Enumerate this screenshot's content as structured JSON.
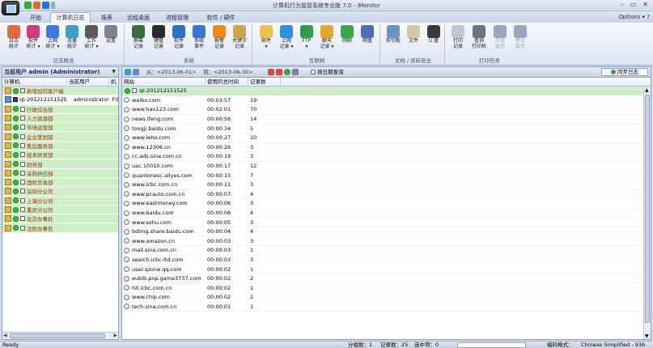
{
  "window": {
    "title": "计算机行为监管系统专业版 7.0 - iMonitor",
    "controls": [
      "–",
      "▭",
      "✕"
    ]
  },
  "tabs": {
    "items": [
      "开始",
      "计算机日志",
      "报表",
      "远程桌面",
      "进程管理",
      "软件 / 硬件"
    ],
    "options": "Options ▾ ?"
  },
  "ribbon": {
    "groups": [
      {
        "label": "日志概览",
        "buttons": [
          {
            "label": "日志\n统计",
            "color": "#e46b3a"
          },
          {
            "label": "软件\n统计 ▾",
            "color": "#d33c7a"
          },
          {
            "label": "上网\n统计 ▾",
            "color": "#3d7be0"
          },
          {
            "label": "流量\n统计",
            "color": "#3aa0c8"
          },
          {
            "label": "工作\n统计 ▾",
            "color": "#5a5a5a"
          },
          {
            "label": "设置",
            "color": "#7a8494"
          }
        ]
      },
      {
        "label": "系统",
        "buttons": [
          {
            "label": "屏幕\n记录",
            "color": "#3d6b3d"
          },
          {
            "label": "键盘\n记录",
            "color": "#2a2a2a"
          },
          {
            "label": "软件\n记录",
            "color": "#2f6fc4"
          },
          {
            "label": "系统\n事件",
            "color": "#3a78d8"
          },
          {
            "label": "报警\n记录",
            "color": "#f08a17"
          },
          {
            "label": "关键字\n记录",
            "color": "#c8a84a"
          }
        ]
      },
      {
        "label": "互联网",
        "buttons": [
          {
            "label": "邮件\n▾",
            "color": "#e8c24a"
          },
          {
            "label": "上网\n记录 ▾",
            "color": "#2f8fe0"
          },
          {
            "label": "FTP\n▾",
            "color": "#2f9f4a"
          },
          {
            "label": "聊天\n记录 ▾",
            "color": "#e0a82f"
          },
          {
            "label": "网邮",
            "color": "#38a84a"
          },
          {
            "label": "网盘",
            "color": "#4a6fb8"
          }
        ]
      },
      {
        "label": "文档 / 资料安全",
        "buttons": [
          {
            "label": "剪切板",
            "color": "#6a94c8"
          },
          {
            "label": "文件",
            "color": "#d4c8a0"
          },
          {
            "label": "U 盘",
            "color": "#3a3a3a"
          }
        ]
      },
      {
        "label": "打印任务",
        "buttons": [
          {
            "label": "打印\n记录",
            "color": "#bfc7d4"
          },
          {
            "label": "查询\n打印机",
            "color": "#6a7484"
          },
          {
            "label": "开始\n监控",
            "color": "#9aa7bf",
            "disabled": true
          },
          {
            "label": "停止\n监控",
            "color": "#9aa7bf",
            "disabled": true
          }
        ]
      }
    ]
  },
  "left_pane": {
    "header": "当前用户 admin (Administrator)",
    "columns": [
      "计算机",
      "当前用户",
      "机"
    ],
    "rows": [
      {
        "type": "dept",
        "name": "新增加的客户端"
      },
      {
        "type": "host",
        "name": "qt-201212151525",
        "user": "administrator",
        "mac": "F0"
      },
      {
        "type": "dept",
        "name": "行政综合部"
      },
      {
        "type": "dept",
        "name": "人力资源部"
      },
      {
        "type": "dept",
        "name": "市场运营部"
      },
      {
        "type": "dept",
        "name": "企业策划部"
      },
      {
        "type": "dept",
        "name": "售后服务部"
      },
      {
        "type": "dept",
        "name": "技术研发部"
      },
      {
        "type": "dept",
        "name": "财务部"
      },
      {
        "type": "dept",
        "name": "采购供应部"
      },
      {
        "type": "dept",
        "name": "国际贸易部"
      },
      {
        "type": "dept",
        "name": "深圳分公司"
      },
      {
        "type": "dept",
        "name": "上海分公司"
      },
      {
        "type": "dept",
        "name": "重庆分公司"
      },
      {
        "type": "dept",
        "name": "北京办事处"
      },
      {
        "type": "dept",
        "name": "沈阳办事处"
      }
    ]
  },
  "right_pane": {
    "toolbar": {
      "from_label": "从：<2013-06-01>",
      "to_label": "到：<2013-06-30>",
      "query_label": "按日期查询",
      "sync_label": "同步日志"
    },
    "columns": [
      "网站",
      "使用的总时间",
      "记录数"
    ],
    "group": "qt-201212151525",
    "rows": [
      {
        "site": "weibo.com",
        "time": "00:03:57",
        "count": "19"
      },
      {
        "site": "www.hao123.com",
        "time": "00:02:01",
        "count": "70"
      },
      {
        "site": "news.ifeng.com",
        "time": "00:00:56",
        "count": "14"
      },
      {
        "site": "tongji.baidu.com",
        "time": "00:00:34",
        "count": "5"
      },
      {
        "site": "www.leho.com",
        "time": "00:00:27",
        "count": "10"
      },
      {
        "site": "www.12306.cn",
        "time": "00:00:26",
        "count": "3"
      },
      {
        "site": "cc.ads.sina.com.cn",
        "time": "00:00:19",
        "count": "3"
      },
      {
        "site": "uac.10010.com",
        "time": "00:00:17",
        "count": "12"
      },
      {
        "site": "quantonesc.allyes.com",
        "time": "00:00:15",
        "count": "7"
      },
      {
        "site": "www.icbc.com.cn",
        "time": "00:00:11",
        "count": "3"
      },
      {
        "site": "www.pcauto.com.cn",
        "time": "00:00:07",
        "count": "4"
      },
      {
        "site": "www.eastmoney.com",
        "time": "00:00:06",
        "count": "3"
      },
      {
        "site": "www.baidu.com",
        "time": "00:00:06",
        "count": "4"
      },
      {
        "site": "www.sohu.com",
        "time": "00:00:05",
        "count": "3"
      },
      {
        "site": "bdimg.share.baidu.com",
        "time": "00:00:04",
        "count": "4"
      },
      {
        "site": "www.amazon.cn",
        "time": "00:00:03",
        "count": "3"
      },
      {
        "site": "mail.sina.com.cn",
        "time": "00:00:03",
        "count": "1"
      },
      {
        "site": "search.icbc-ltd.com",
        "time": "00:00:03",
        "count": "3"
      },
      {
        "site": "user.qzone.qq.com",
        "time": "00:00:02",
        "count": "1"
      },
      {
        "site": "eubib.pop.game3737.com",
        "time": "00:00:02",
        "count": "2"
      },
      {
        "site": "hit.icbc.com.cn",
        "time": "00:00:02",
        "count": "1"
      },
      {
        "site": "www.chip.com",
        "time": "00:00:02",
        "count": "2"
      },
      {
        "site": "tech.sina.com.cn",
        "time": "00:00:01",
        "count": "1"
      }
    ]
  },
  "status": {
    "left": "Ready",
    "groups": "分组数：1",
    "records": "记录数：25",
    "selected": "选中项：0",
    "encoding_label": "编码格式：",
    "encoding_value": "Chinese Simplified - 936"
  }
}
